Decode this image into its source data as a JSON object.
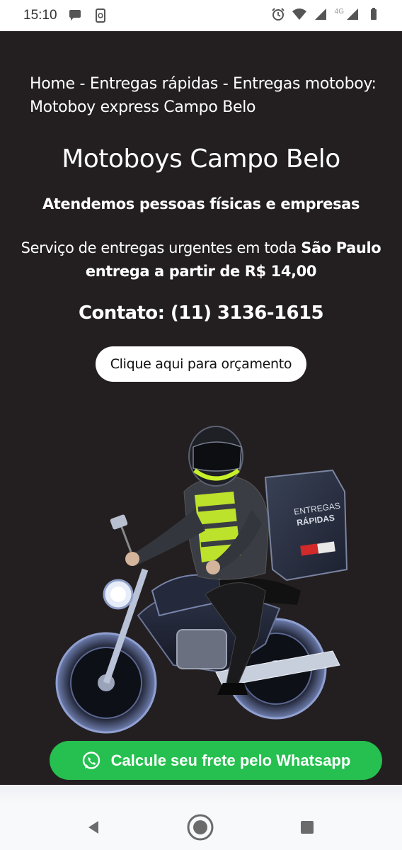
{
  "status_bar": {
    "time": "15:10",
    "network_label": "4G",
    "left_icons": [
      "chat-bubble-icon",
      "phone-update-icon"
    ],
    "right_icons": [
      "alarm-icon",
      "wifi-icon",
      "signal-icon",
      "signal-4g-icon",
      "battery-icon"
    ]
  },
  "breadcrumb": {
    "items": [
      "Home",
      "Entregas rápidas",
      "Entregas motoboy: Motoboy express Campo Belo"
    ],
    "separator": " - "
  },
  "hero": {
    "title": "Motoboys Campo Belo",
    "subtitle": "Atendemos pessoas físicas e empresas",
    "service_prefix": "Serviço de entregas urgentes em toda ",
    "service_city": "São Paulo",
    "service_price": "entrega a partir de R$ 14,00",
    "contact": "Contato: (11) 3136-1615",
    "quote_button": "Clique aqui para orçamento"
  },
  "illustration": {
    "box_text_line1": "ENTREGAS",
    "box_text_line2": "RÁPIDAS"
  },
  "whatsapp": {
    "label": "Calcule seu frete pelo Whatsapp",
    "icon": "whatsapp-icon"
  },
  "nav_bar": {
    "buttons": [
      "back-icon",
      "home-icon",
      "recents-icon"
    ]
  },
  "colors": {
    "background": "#231f20",
    "whatsapp_green": "#25c04f",
    "text": "#ffffff",
    "vest_yellow": "#c8f02a"
  }
}
